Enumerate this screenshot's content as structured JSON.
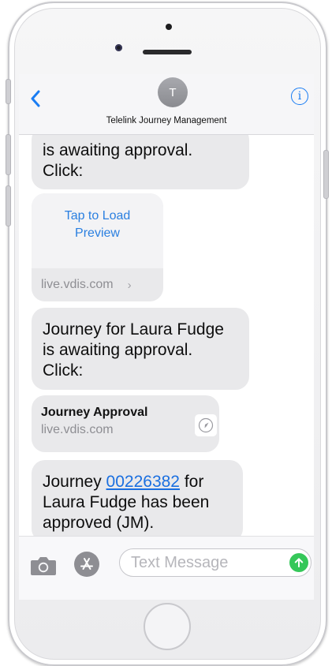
{
  "header": {
    "contact_initial": "T",
    "contact_name": "Telelink Journey Management",
    "accent_color": "#1a7df3"
  },
  "messages": {
    "msg1": {
      "line1": "is awaiting approval.",
      "line2": "Click:"
    },
    "preview1": {
      "tap_line1": "Tap to Load",
      "tap_line2": "Preview",
      "domain": "live.vdis.com",
      "chevron": "›"
    },
    "msg2": {
      "line1": "Journey for Laura Fudge",
      "line2": "is awaiting approval.",
      "line3": "Click:"
    },
    "preview2": {
      "title": "Journey Approval",
      "domain": "live.vdis.com",
      "icon": "compass-icon"
    },
    "msg3": {
      "prefix": "Journey ",
      "link_number": "00226382",
      "suffix": " for",
      "line2": "Laura Fudge has been",
      "line3": "approved (JM)."
    }
  },
  "input_bar": {
    "placeholder": "Text Message",
    "value": "",
    "send_color": "#35c759"
  },
  "colors": {
    "bubble_received": "#e9e9eb",
    "link": "#1a6fe0"
  }
}
